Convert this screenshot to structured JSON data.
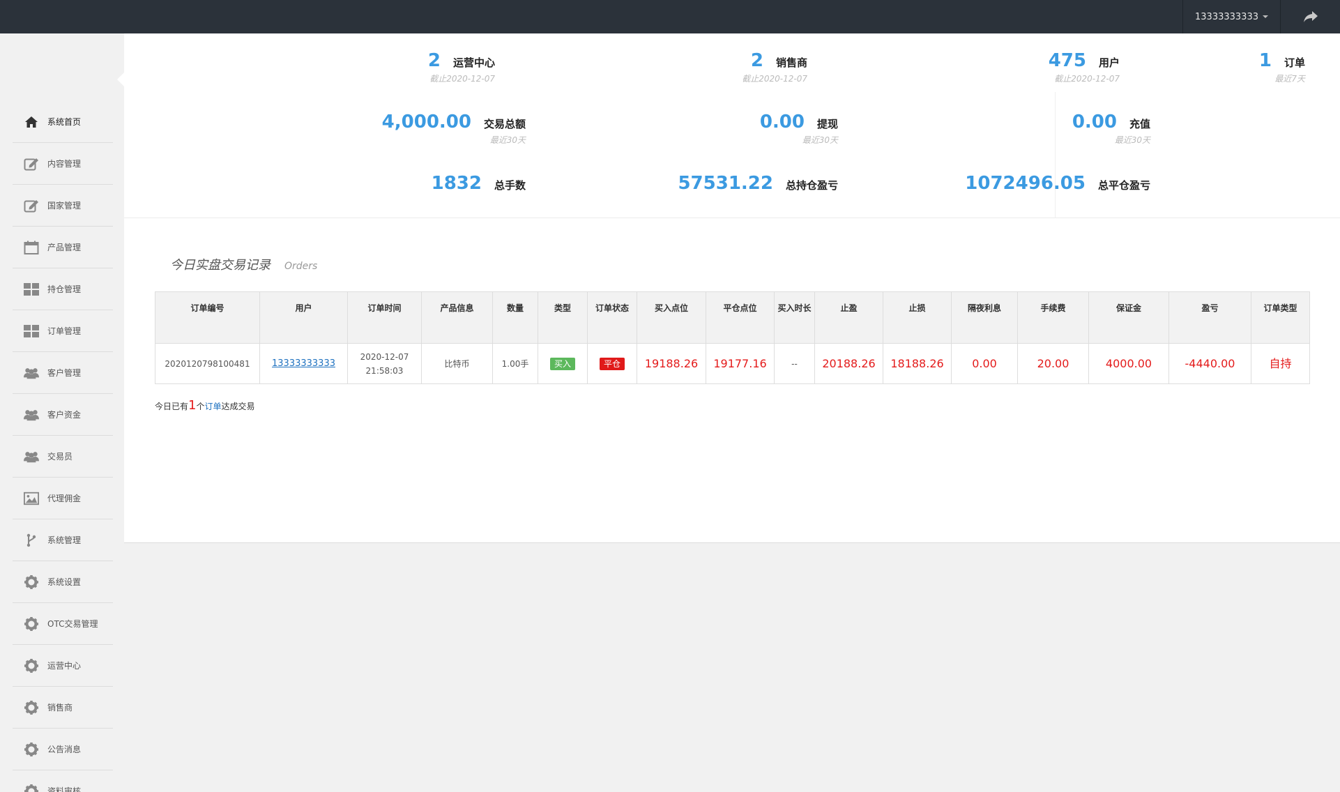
{
  "topbar": {
    "user": "13333333333",
    "logout_icon": "share-arrow-icon"
  },
  "sidebar": {
    "items": [
      {
        "label": "系统首页",
        "icon": "home-icon"
      },
      {
        "label": "内容管理",
        "icon": "edit-icon"
      },
      {
        "label": "国家管理",
        "icon": "edit-icon"
      },
      {
        "label": "产品管理",
        "icon": "calendar-icon"
      },
      {
        "label": "持仓管理",
        "icon": "grid-icon"
      },
      {
        "label": "订单管理",
        "icon": "grid-icon"
      },
      {
        "label": "客户管理",
        "icon": "users-icon"
      },
      {
        "label": "客户资金",
        "icon": "users-icon"
      },
      {
        "label": "交易员",
        "icon": "users-icon"
      },
      {
        "label": "代理佣金",
        "icon": "image-icon"
      },
      {
        "label": "系统管理",
        "icon": "branch-icon"
      },
      {
        "label": "系统设置",
        "icon": "gear-icon"
      },
      {
        "label": "OTC交易管理",
        "icon": "gear-icon"
      },
      {
        "label": "运营中心",
        "icon": "gear-icon"
      },
      {
        "label": "销售商",
        "icon": "gear-icon"
      },
      {
        "label": "公告消息",
        "icon": "gear-icon"
      },
      {
        "label": "资料审核",
        "icon": "gear-icon"
      }
    ]
  },
  "stats": {
    "ops_center": {
      "value": "2",
      "label": "运营中心",
      "sub": "截止2020-12-07"
    },
    "sellers": {
      "value": "2",
      "label": "销售商",
      "sub": "截止2020-12-07"
    },
    "users": {
      "value": "475",
      "label": "用户",
      "sub": "截止2020-12-07"
    },
    "orders": {
      "value": "1",
      "label": "订单",
      "sub": "最近7天"
    },
    "trade_total": {
      "value": "4,000.00",
      "label": "交易总额",
      "sub": "最近30天"
    },
    "withdraw": {
      "value": "0.00",
      "label": "提现",
      "sub": "最近30天"
    },
    "recharge": {
      "value": "0.00",
      "label": "充值",
      "sub": "最近30天"
    },
    "total_lots": {
      "value": "1832",
      "label": "总手数"
    },
    "hold_pnl": {
      "value": "57531.22",
      "label": "总持仓盈亏"
    },
    "close_pnl": {
      "value": "1072496.05",
      "label": "总平仓盈亏"
    }
  },
  "orders_section": {
    "title": "今日实盘交易记录",
    "subtitle": "Orders",
    "columns": [
      "订单编号",
      "用户",
      "订单时间",
      "产品信息",
      "数量",
      "类型",
      "订单状态",
      "买入点位",
      "平仓点位",
      "买入时长",
      "止盈",
      "止损",
      "隔夜利息",
      "手续费",
      "保证金",
      "盈亏",
      "订单类型"
    ],
    "rows": [
      {
        "order_no": "2020120798100481",
        "user": "13333333333",
        "date": "2020-12-07",
        "time": "21:58:03",
        "product": "比特币",
        "qty": "1.00手",
        "type": "买入",
        "status": "平仓",
        "buy_price": "19188.26",
        "close_price": "19177.16",
        "duration": "--",
        "take_profit": "20188.26",
        "stop_loss": "18188.26",
        "overnight": "0.00",
        "fee": "20.00",
        "margin": "4000.00",
        "pnl": "-4440.00",
        "order_type": "自持"
      }
    ],
    "summary": {
      "prefix": "今日已有",
      "count": "1",
      "mid": "个",
      "link": "订单",
      "suffix": "达成交易"
    }
  }
}
